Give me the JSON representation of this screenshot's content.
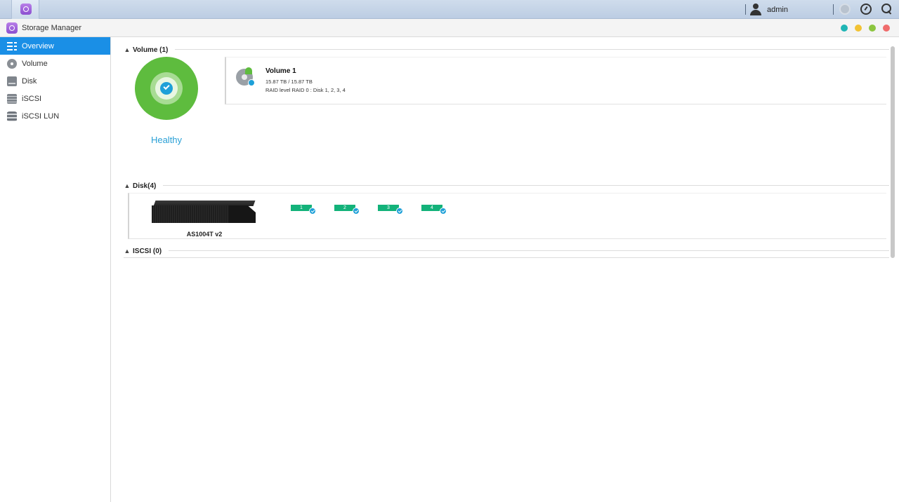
{
  "taskbar": {
    "user_name": "admin",
    "icons": [
      "storage-manager-icon",
      "user-icon",
      "notification-icon",
      "dashboard-icon",
      "search-icon"
    ]
  },
  "window": {
    "title": "Storage Manager",
    "control_colors": [
      "#1fb5b5",
      "#f2c233",
      "#8cc53f",
      "#ef6b6b"
    ]
  },
  "sidebar": {
    "items": [
      {
        "label": "Overview",
        "icon": "overview-icon",
        "active": true
      },
      {
        "label": "Volume",
        "icon": "volume-icon",
        "active": false
      },
      {
        "label": "Disk",
        "icon": "disk-icon",
        "active": false
      },
      {
        "label": "iSCSI",
        "icon": "iscsi-icon",
        "active": false
      },
      {
        "label": "iSCSI LUN",
        "icon": "iscsi-lun-icon",
        "active": false
      }
    ]
  },
  "overview": {
    "volume_section": {
      "title": "Volume (1)",
      "status": "Healthy",
      "volumes": [
        {
          "name": "Volume 1",
          "capacity": "15.87 TB / 15.87 TB",
          "raid": "RAID level RAID 0 : Disk 1, 2, 3, 4"
        }
      ]
    },
    "disk_section": {
      "title": "Disk(4)",
      "device_name": "AS1004T v2",
      "bays": [
        "1",
        "2",
        "3",
        "4"
      ]
    },
    "iscsi_section": {
      "title": "ISCSI (0)"
    }
  },
  "colors": {
    "accent": "#1a8fe6",
    "healthy": "#5ebc3e",
    "bay": "#13b27a",
    "check": "#1ea0d8"
  }
}
